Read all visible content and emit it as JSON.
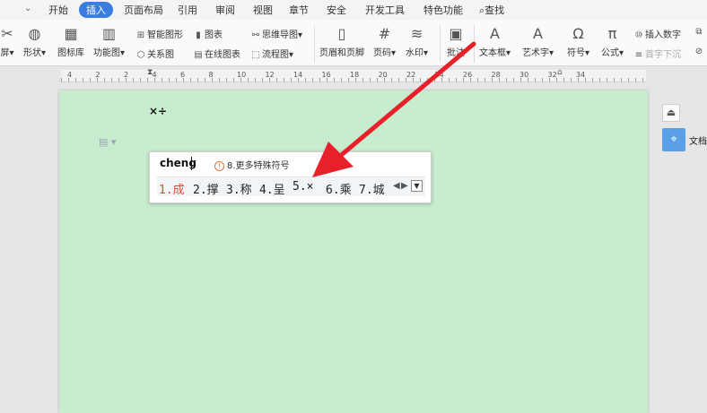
{
  "menu": {
    "items": [
      "开始",
      "插入",
      "页面布局",
      "引用",
      "审阅",
      "视图",
      "章节",
      "安全",
      "开发工具",
      "特色功能",
      "查找"
    ],
    "active_index": 1
  },
  "ribbon": {
    "screen": "屏",
    "shape": "形状",
    "icon_lib": "图标库",
    "func_chart": "功能图",
    "smart_shape": "智能图形",
    "chart": "图表",
    "relation_chart": "关系图",
    "online_chart": "在线图表",
    "mind_map": "思维导图",
    "flow_chart": "流程图",
    "header_footer": "页眉和页脚",
    "page_num": "页码",
    "watermark": "水印",
    "comment": "批注",
    "text_box": "文本框",
    "word_art": "艺术字",
    "symbol": "符号",
    "formula": "公式",
    "insert_number": "插入数字",
    "drop_cap": "首字下沉",
    "doc_label": "文档"
  },
  "ruler": {
    "labels": [
      "4",
      "2",
      "2",
      "4",
      "6",
      "8",
      "10",
      "12",
      "14",
      "16",
      "18",
      "20",
      "22",
      "24",
      "26",
      "28",
      "30",
      "32",
      "34"
    ]
  },
  "document": {
    "text": "×÷"
  },
  "ime": {
    "pinyin": "cheng",
    "hint": "8.更多特殊符号",
    "candidates": [
      "1.成",
      "2.撑",
      "3.称",
      "4.呈",
      "5.×",
      "6.乘",
      "7.城"
    ],
    "selected_index": 0
  },
  "colors": {
    "accent": "#3b7ce0",
    "page_bg": "#c8ecce",
    "arrow": "#e8202a",
    "candidate_selected": "#e8462b"
  }
}
